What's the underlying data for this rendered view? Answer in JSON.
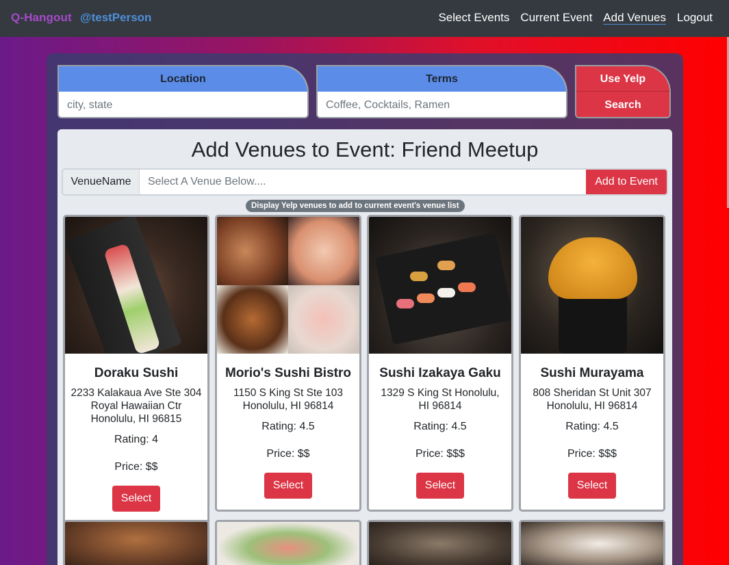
{
  "navbar": {
    "brand": "Q-Hangout",
    "user": "@testPerson",
    "links": [
      "Select Events",
      "Current Event",
      "Add Venues",
      "Logout"
    ],
    "active_link": "Add Venues"
  },
  "search": {
    "location_label": "Location",
    "location_placeholder": "city, state",
    "terms_label": "Terms",
    "terms_placeholder": "Coffee, Cocktails, Ramen",
    "yelp_label": "Use Yelp",
    "search_button": "Search"
  },
  "main": {
    "title": "Add Venues to Event: Friend Meetup",
    "venue_name_label": "VenueName",
    "venue_placeholder": "Select A Venue Below....",
    "add_button": "Add to Event",
    "badge": "Display Yelp venues to add to current event's venue list"
  },
  "venues": [
    {
      "name": "Doraku Sushi",
      "address": "2233 Kalakaua Ave Ste 304 Royal Hawaiian Ctr Honolulu, HI 96815",
      "rating": "Rating: 4",
      "price": "Price: $$",
      "select": "Select"
    },
    {
      "name": "Morio's Sushi Bistro",
      "address": "1150 S King St Ste 103 Honolulu, HI 96814",
      "rating": "Rating: 4.5",
      "price": "Price: $$",
      "select": "Select"
    },
    {
      "name": "Sushi Izakaya Gaku",
      "address": "1329 S King St Honolulu, HI 96814",
      "rating": "Rating: 4.5",
      "price": "Price: $$$",
      "select": "Select"
    },
    {
      "name": "Sushi Murayama",
      "address": "808 Sheridan St Unit 307 Honolulu, HI 96814",
      "rating": "Rating: 4.5",
      "price": "Price: $$$",
      "select": "Select"
    }
  ],
  "colors": {
    "accent_red": "#dc3545",
    "header_blue": "#5b8de8",
    "navbar": "#343a40",
    "brand": "#a64ac9",
    "user": "#4e8fd9"
  }
}
